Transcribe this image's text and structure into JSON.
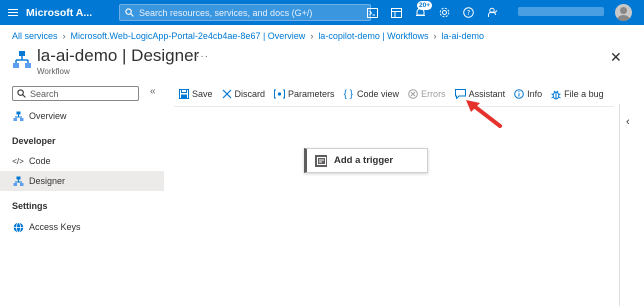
{
  "header": {
    "brand": "Microsoft A...",
    "search_placeholder": "Search resources, services, and docs (G+/)",
    "notifications_badge": "20+"
  },
  "breadcrumb": [
    "All services",
    "Microsoft.Web-LogicApp-Portal-2e4cb4ae-8e67 | Overview",
    "la-copilot-demo | Workflows",
    "la-ai-demo"
  ],
  "page": {
    "title": "la-ai-demo | Designer",
    "subtitle": "Workflow",
    "more": "···"
  },
  "sidebar": {
    "search_placeholder": "Search",
    "items_top": [
      {
        "label": "Overview",
        "icon": "workflow-icon"
      }
    ],
    "sections": [
      {
        "title": "Developer",
        "items": [
          {
            "label": "Code",
            "icon": "code-icon",
            "selected": false
          },
          {
            "label": "Designer",
            "icon": "workflow-icon",
            "selected": true
          }
        ]
      },
      {
        "title": "Settings",
        "items": [
          {
            "label": "Access Keys",
            "icon": "globe-icon",
            "selected": false
          }
        ]
      }
    ]
  },
  "toolbar": {
    "save": "Save",
    "discard": "Discard",
    "parameters": "Parameters",
    "code_view": "Code view",
    "errors": "Errors",
    "assistant": "Assistant",
    "info": "Info",
    "file_bug": "File a bug"
  },
  "canvas": {
    "trigger_label": "Add a trigger"
  },
  "colors": {
    "accent": "#0078d4",
    "annotation_arrow": "#e5322d"
  }
}
